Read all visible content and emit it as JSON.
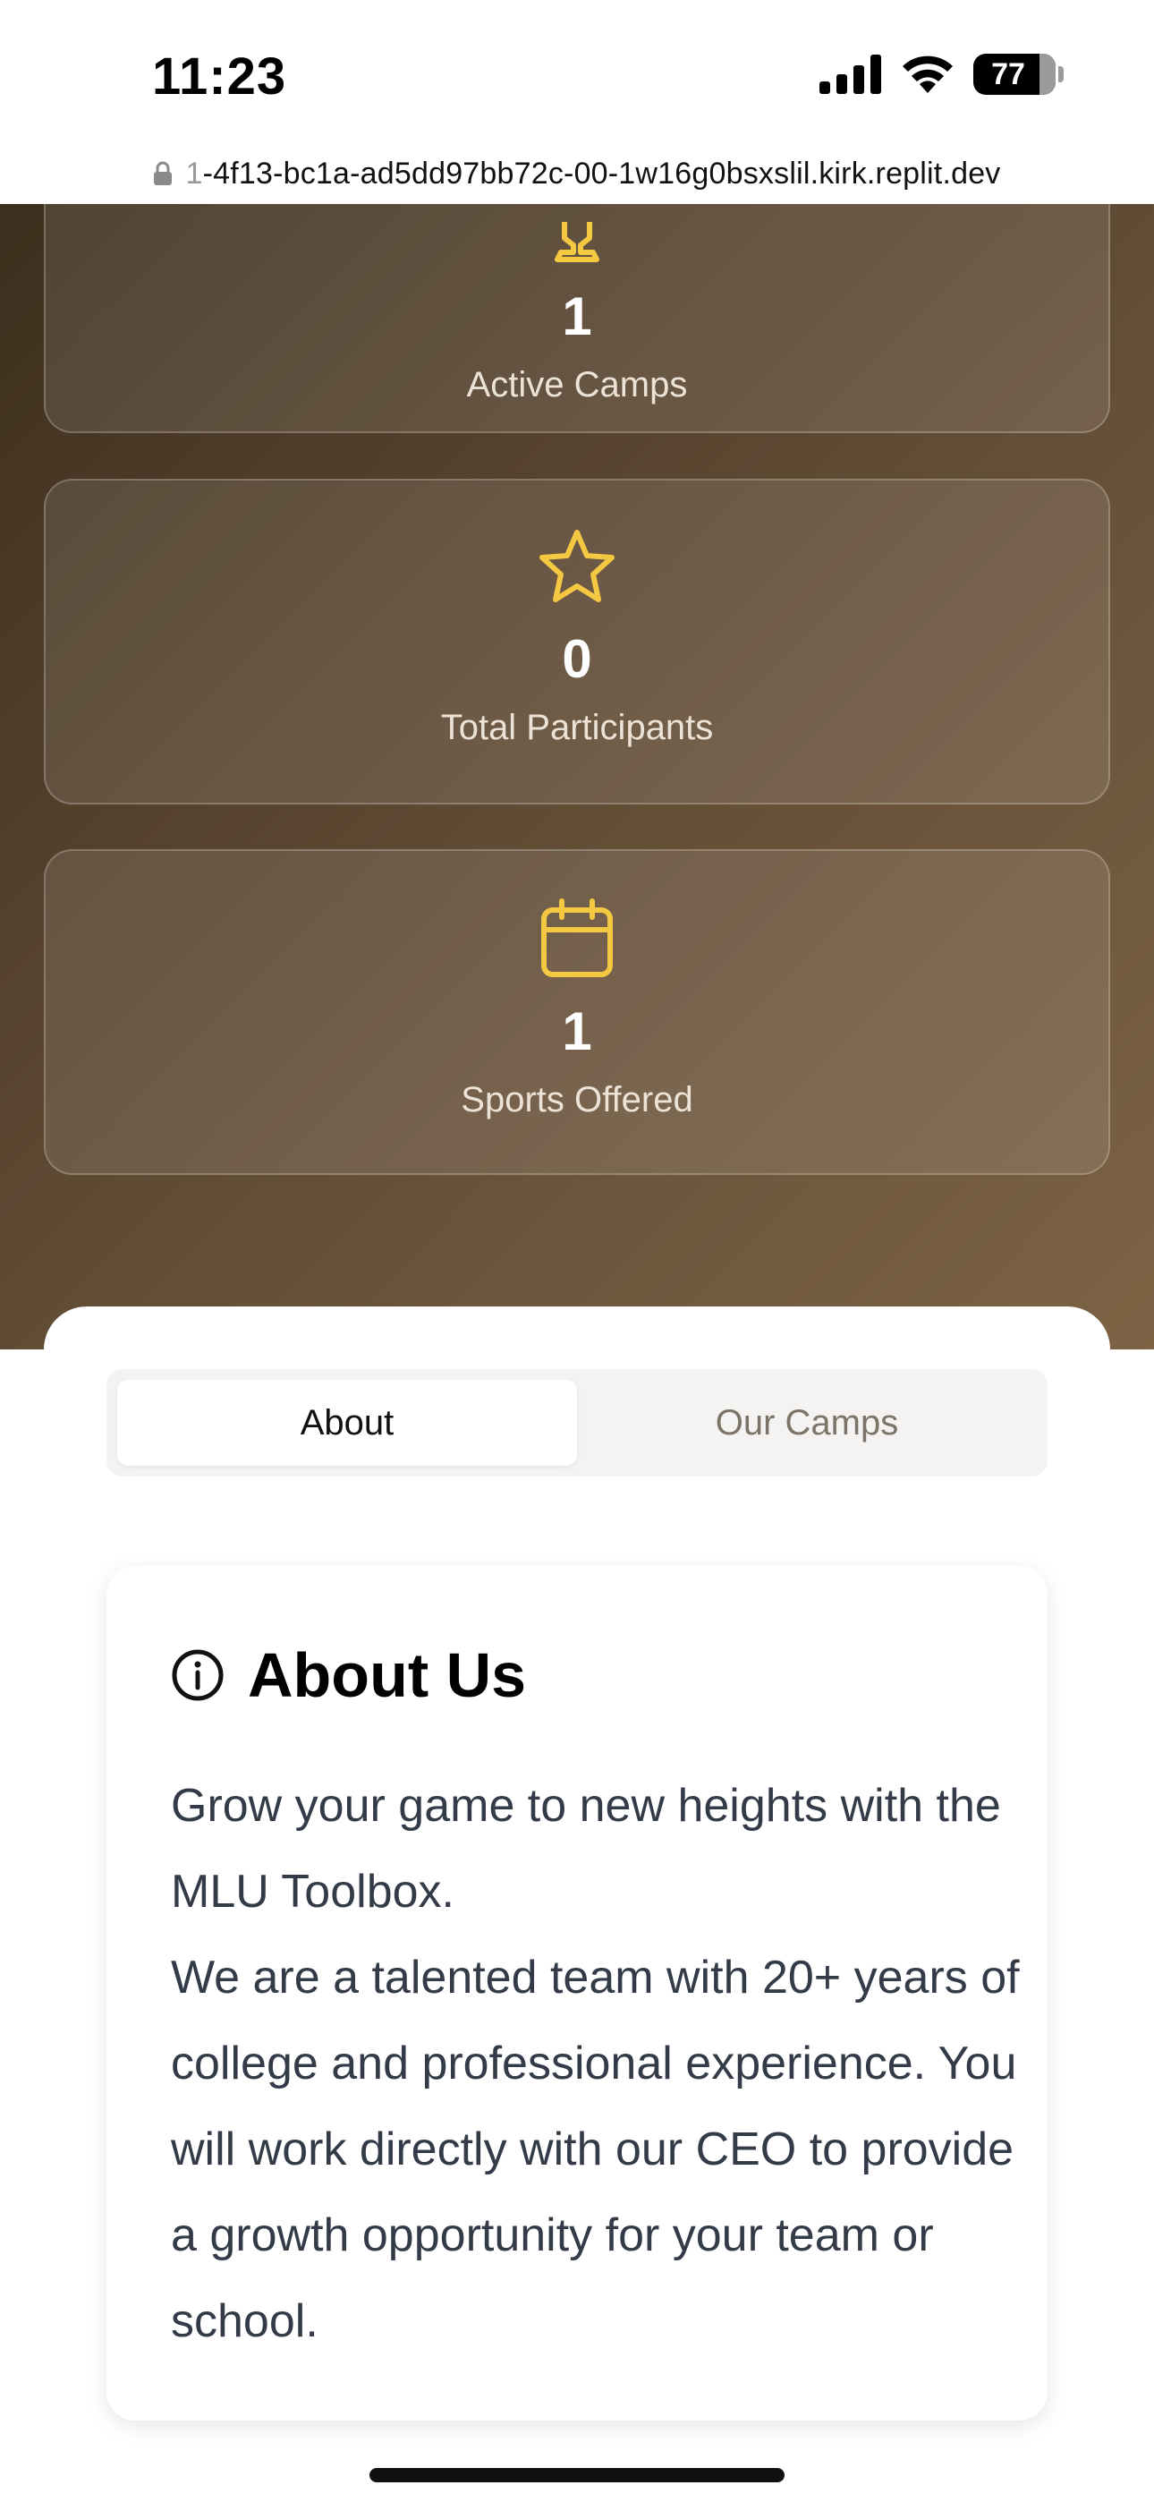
{
  "status_bar": {
    "time": "11:23",
    "battery_level": "77"
  },
  "browser": {
    "url_faded_prefix": "1",
    "url": "-4f13-bc1a-ad5dd97bb72c-00-1w16g0bsxslil.kirk.replit.dev"
  },
  "stats": [
    {
      "value": "1",
      "label": "Active Camps",
      "icon": "trophy-icon"
    },
    {
      "value": "0",
      "label": "Total Participants",
      "icon": "star-icon"
    },
    {
      "value": "1",
      "label": "Sports Offered",
      "icon": "calendar-icon"
    }
  ],
  "tabs": [
    {
      "label": "About",
      "active": true
    },
    {
      "label": "Our Camps",
      "active": false
    }
  ],
  "about": {
    "title": "About Us",
    "paragraph1": "Grow your game to new heights with the MLU Toolbox.",
    "paragraph2": "We are a talented team with 20+ years of college and professional experience. You will work directly with our CEO to provide a growth opportunity for your team or school."
  },
  "colors": {
    "accent_icon": "#f5c842",
    "hero_dark": "#3d2e1d",
    "hero_light": "#7d6344",
    "body_text": "#333a48"
  }
}
